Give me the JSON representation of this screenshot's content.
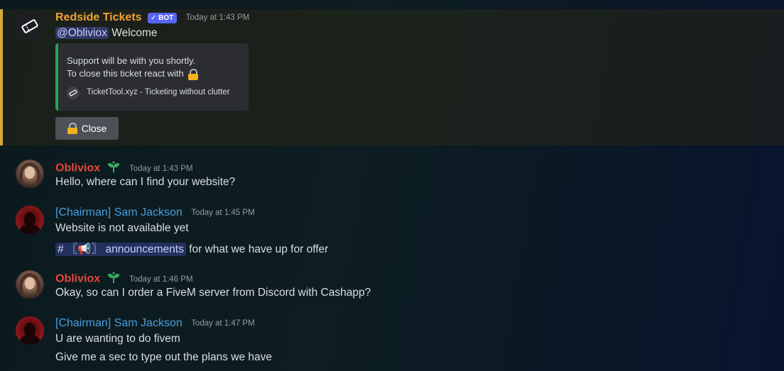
{
  "bot_message": {
    "username": "Redside Tickets",
    "bot_tag": "✓ BOT",
    "timestamp": "Today at 1:43 PM",
    "mention": "@Obliviox",
    "text": "Welcome",
    "embed": {
      "line1": "Support will be with you shortly.",
      "line2": "To close this ticket react with",
      "footer": "TicketTool.xyz - Ticketing without clutter"
    },
    "button_label": "Close"
  },
  "messages": [
    {
      "username": "Obliviox",
      "timestamp": "Today at 1:43 PM",
      "lines": [
        "Hello, where can I find your website?"
      ]
    },
    {
      "username": "[Chairman] Sam Jackson",
      "timestamp": "Today at 1:45 PM",
      "lines": [
        "Website is not available yet"
      ],
      "channel": "# 〖📢〗 announcements",
      "channel_suffix": "for what we have up for offer"
    },
    {
      "username": "Obliviox",
      "timestamp": "Today at 1:46 PM",
      "lines": [
        "Okay, so can I order a FiveM server from Discord with Cashapp?"
      ]
    },
    {
      "username": "[Chairman] Sam Jackson",
      "timestamp": "Today at 1:47 PM",
      "lines": [
        "U are wanting to do fivem",
        "Give me a sec to type out the plans we have"
      ]
    }
  ],
  "colors": {
    "bot_name": "#f0a232",
    "obliviox_name": "#e8453a",
    "chairman_name": "#4a9de0",
    "mention_bar": "#d2a93b",
    "embed_bar": "#23a559"
  },
  "icons": {
    "bot_avatar": "ticket-icon",
    "badge": "sprout-icon",
    "lock": "lock-icon"
  }
}
